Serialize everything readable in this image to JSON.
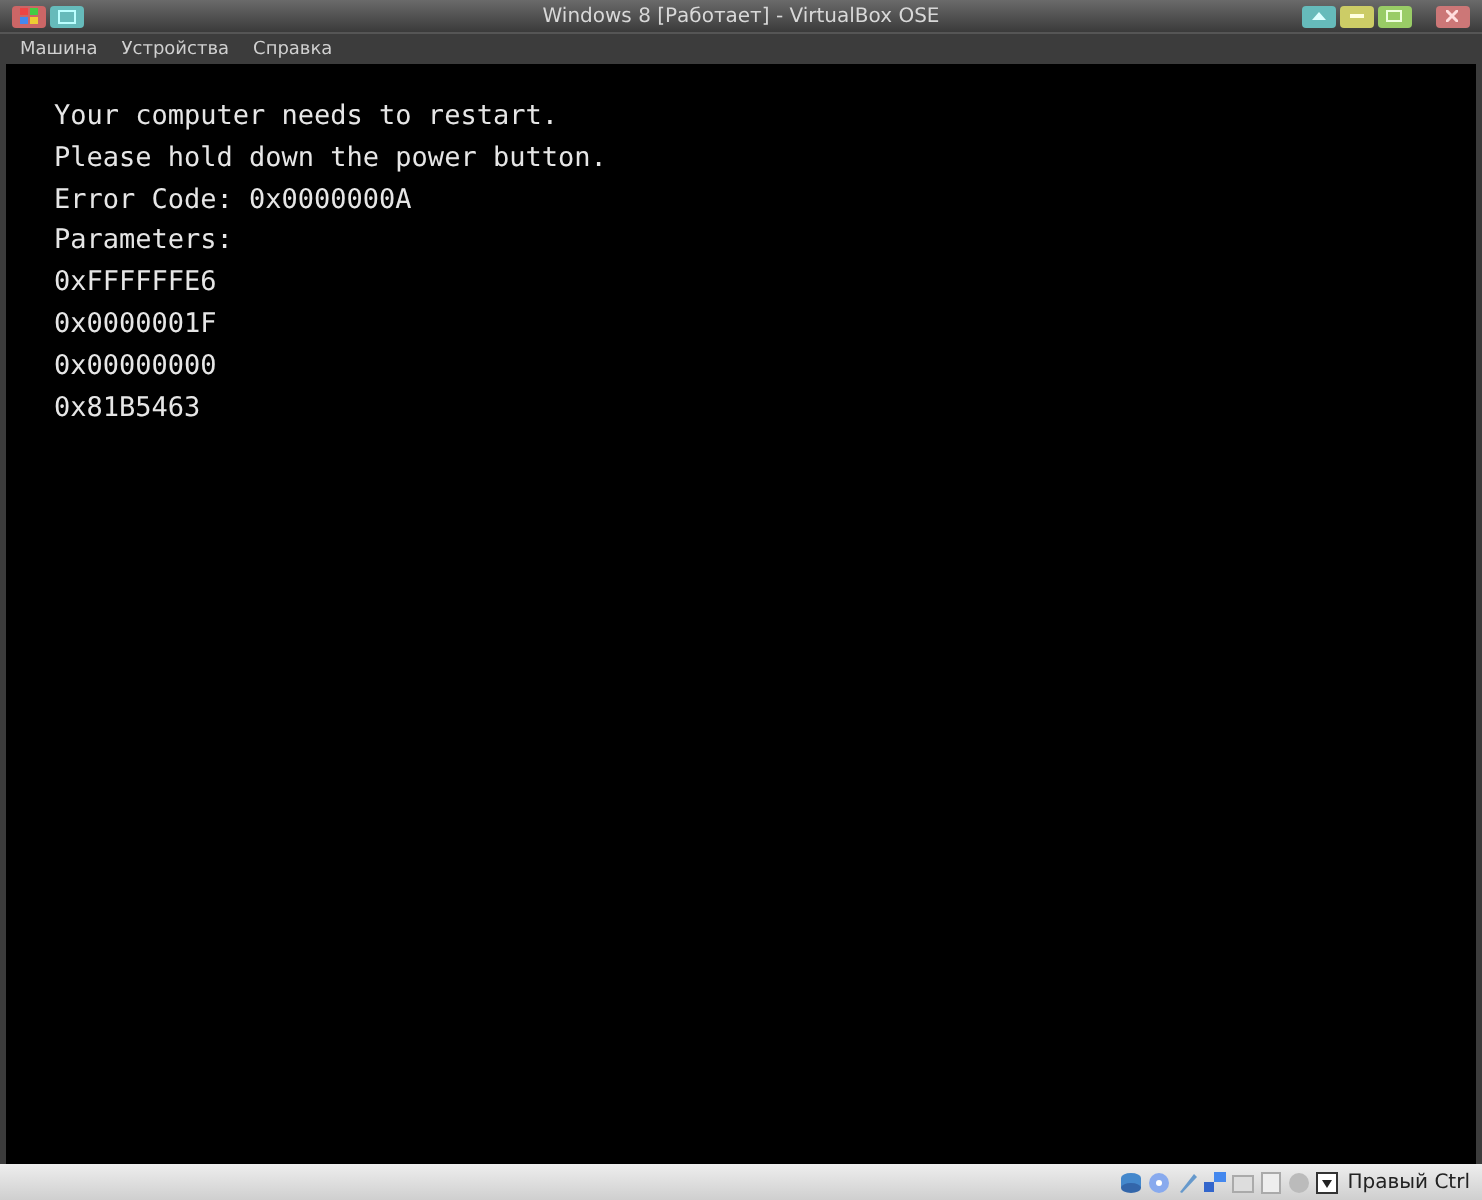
{
  "window": {
    "title": "Windows 8 [Работает] - VirtualBox OSE"
  },
  "menu": [
    {
      "label": "Машина"
    },
    {
      "label": "Устройства"
    },
    {
      "label": "Справка"
    }
  ],
  "screen": {
    "lines": [
      "Your computer needs to restart.",
      "Please hold down the power button.",
      "Error Code: 0x0000000A",
      "Parameters:",
      "0xFFFFFFE6",
      "0x0000001F",
      "0x00000000",
      "0x81B5463"
    ]
  },
  "status_bar": {
    "host_key": "Правый Ctrl"
  }
}
